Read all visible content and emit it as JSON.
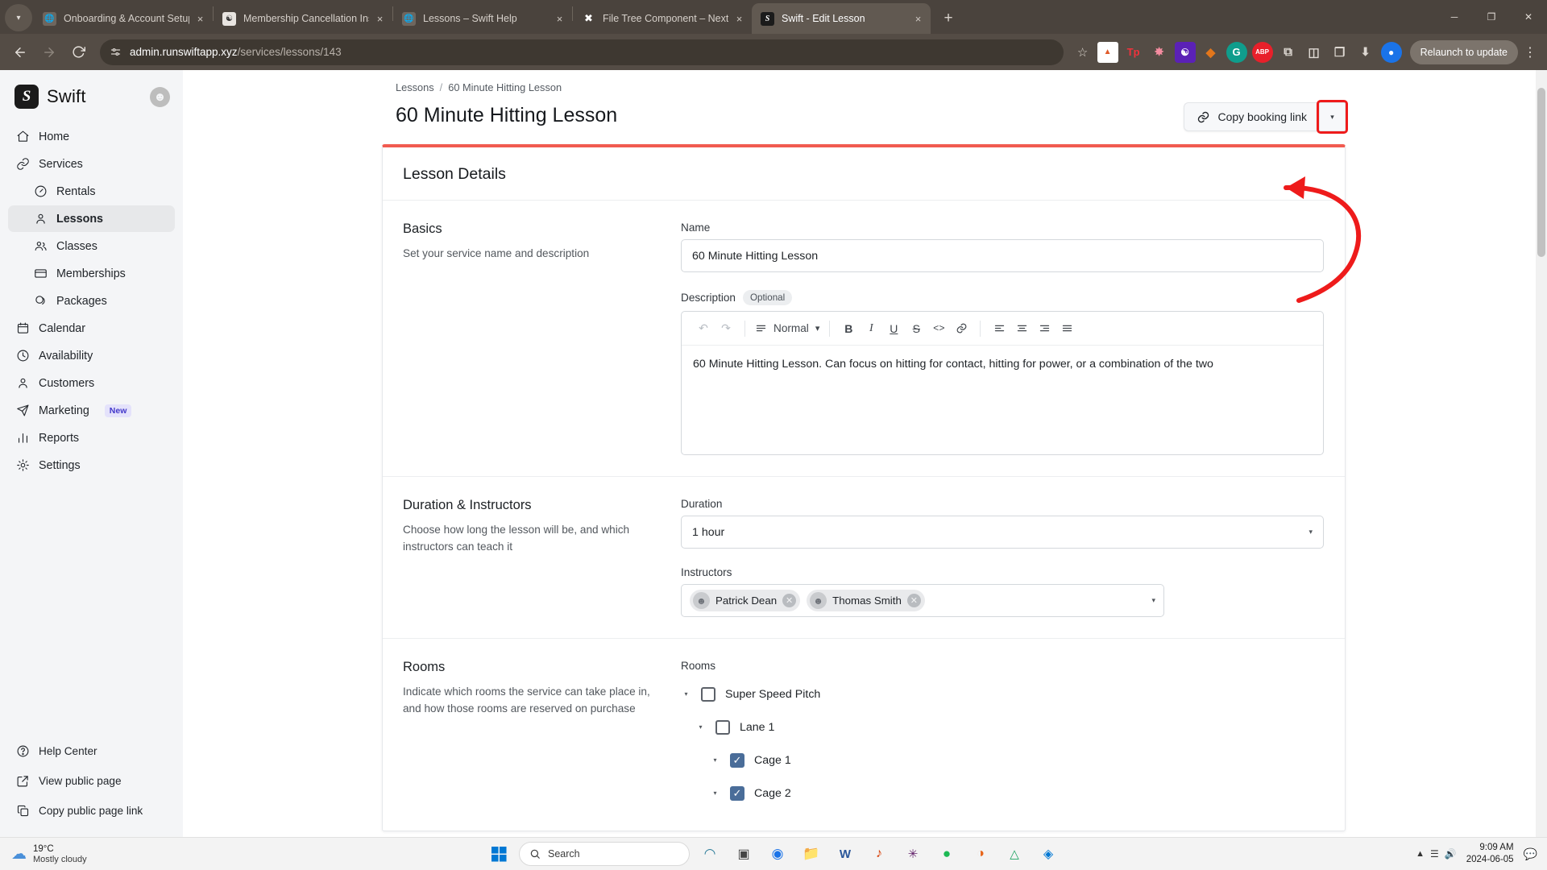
{
  "browser": {
    "tabs": [
      {
        "title": "Onboarding & Account Setup -",
        "favicon": "globe-icon",
        "active": false
      },
      {
        "title": "Membership Cancellation Instr",
        "favicon": "spiral-icon",
        "active": false
      },
      {
        "title": "Lessons – Swift Help",
        "favicon": "globe-icon",
        "active": false
      },
      {
        "title": "File Tree Component – Nextra",
        "favicon": "nextra-icon",
        "active": false
      },
      {
        "title": "Swift - Edit Lesson",
        "favicon": "swift-icon",
        "active": true
      }
    ],
    "close_label": "×",
    "newtab_label": "+",
    "nav": {
      "back": "←",
      "forward": "→",
      "reload": "↻"
    },
    "url": {
      "host": "admin.runswiftapp.xyz",
      "path": "/services/lessons/143"
    },
    "site_info_icon": "page-info-icon",
    "star_icon": "☆",
    "extensions": [
      {
        "name": "unpkg-extension",
        "glyph": "■",
        "bg": "#ffffff",
        "fg": "#e05b2a"
      },
      {
        "name": "testing-platform-extension",
        "glyph": "Tp",
        "bg": "#4a433d",
        "fg": "#f0323c"
      },
      {
        "name": "butterfly-extension",
        "glyph": "❈",
        "bg": "#4a433d",
        "fg": "#f58ca0"
      },
      {
        "name": "wallet-extension",
        "glyph": "⬟",
        "bg": "#5b21b6",
        "fg": "#ffffff"
      },
      {
        "name": "metamask-extension",
        "glyph": "◆",
        "bg": "#4a433d",
        "fg": "#e2761b"
      },
      {
        "name": "google-extension",
        "glyph": "G",
        "bg": "#0f9d8c",
        "fg": "#ffffff"
      },
      {
        "name": "adblock-plus-extension",
        "glyph": "ABP",
        "bg": "#e8202a",
        "fg": "#ffffff"
      }
    ],
    "download_icon": "⬇",
    "profile_icon": "profile-avatar",
    "extensions_puzzle_icon": "⧉",
    "relaunch_label": "Relaunch to update",
    "menu_icon": "⋮",
    "window": {
      "minimize": "─",
      "maximize": "❐",
      "close": "✕"
    }
  },
  "sidebar": {
    "brand": "Swift",
    "logo_glyph": "S",
    "items": [
      {
        "label": "Home",
        "icon": "home-icon",
        "level": 0,
        "active": false
      },
      {
        "label": "Services",
        "icon": "link-icon",
        "level": 0,
        "active": false
      },
      {
        "label": "Rentals",
        "icon": "gauge-icon",
        "level": 1,
        "active": false
      },
      {
        "label": "Lessons",
        "icon": "person-icon",
        "level": 1,
        "active": true
      },
      {
        "label": "Classes",
        "icon": "people-icon",
        "level": 1,
        "active": false
      },
      {
        "label": "Memberships",
        "icon": "card-icon",
        "level": 1,
        "active": false
      },
      {
        "label": "Packages",
        "icon": "coins-icon",
        "level": 1,
        "active": false
      },
      {
        "label": "Calendar",
        "icon": "calendar-icon",
        "level": 0,
        "active": false
      },
      {
        "label": "Availability",
        "icon": "clock-icon",
        "level": 0,
        "active": false
      },
      {
        "label": "Customers",
        "icon": "person-icon",
        "level": 0,
        "active": false
      },
      {
        "label": "Marketing",
        "icon": "send-icon",
        "level": 0,
        "active": false,
        "badge": "New"
      },
      {
        "label": "Reports",
        "icon": "bars-icon",
        "level": 0,
        "active": false
      },
      {
        "label": "Settings",
        "icon": "gear-icon",
        "level": 0,
        "active": false
      }
    ],
    "footer_items": [
      {
        "label": "Help Center",
        "icon": "question-circle-icon"
      },
      {
        "label": "View public page",
        "icon": "external-link-icon"
      },
      {
        "label": "Copy public page link",
        "icon": "copy-icon"
      }
    ]
  },
  "page": {
    "breadcrumb": {
      "parent": "Lessons",
      "separator": "/",
      "current": "60 Minute Hitting Lesson"
    },
    "title": "60 Minute Hitting Lesson",
    "copy_booking_link_label": "Copy booking link",
    "copy_booking_link_icon": "link-icon",
    "copy_booking_caret": "▾",
    "accent_color": "#f15b50",
    "highlight_color": "#ee1b1b"
  },
  "card": {
    "title": "Lesson Details",
    "sections": [
      {
        "heading": "Basics",
        "description": "Set your service name and description",
        "fields": {
          "name_label": "Name",
          "name_value": "60 Minute Hitting Lesson",
          "description_label": "Description",
          "description_optional_badge": "Optional",
          "description_value": "60 Minute Hitting Lesson. Can focus on hitting for contact, hitting for power, or a combination of the two"
        },
        "editor_toolbar": {
          "undo": "undo-icon",
          "redo": "redo-icon",
          "style_icon": "paragraph-icon",
          "style_label": "Normal",
          "style_caret": "⌄",
          "bold": "B",
          "italic": "I",
          "underline": "U",
          "strikethrough": "S",
          "code": "<>",
          "link": "link-icon",
          "align_left": "align-left-icon",
          "align_center": "align-center-icon",
          "align_right": "align-right-icon",
          "align_justify": "align-justify-icon"
        }
      },
      {
        "heading": "Duration & Instructors",
        "description": "Choose how long the lesson will be, and which instructors can teach it",
        "fields": {
          "duration_label": "Duration",
          "duration_value": "1 hour",
          "instructors_label": "Instructors",
          "instructors": [
            {
              "name": "Patrick Dean",
              "remove_label": "✕"
            },
            {
              "name": "Thomas Smith",
              "remove_label": "✕"
            }
          ]
        }
      },
      {
        "heading": "Rooms",
        "description": "Indicate which rooms the service can take place in, and how those rooms are reserved on purchase",
        "fields": {
          "rooms_label": "Rooms",
          "tree": [
            {
              "label": "Super Speed Pitch",
              "depth": 0,
              "checked": false
            },
            {
              "label": "Lane 1",
              "depth": 1,
              "checked": false
            },
            {
              "label": "Cage 1",
              "depth": 2,
              "checked": true
            },
            {
              "label": "Cage 2",
              "depth": 2,
              "checked": true
            }
          ]
        }
      }
    ]
  },
  "taskbar": {
    "weather": {
      "temp": "19°C",
      "desc": "Mostly cloudy",
      "icon": "cloud-icon"
    },
    "start_icon": "windows-icon",
    "search_placeholder": "Search",
    "search_icon": "search-icon",
    "apps": [
      {
        "name": "copilot-taskbar-icon",
        "glyph": "◩",
        "fg": "#2d7d9a"
      },
      {
        "name": "task-view-taskbar-icon",
        "glyph": "▣",
        "fg": "#444"
      },
      {
        "name": "chrome-taskbar-icon",
        "glyph": "◉",
        "fg": "#1a73e8"
      },
      {
        "name": "file-explorer-taskbar-icon",
        "glyph": "▬",
        "fg": "#f2b01e"
      },
      {
        "name": "word-taskbar-icon",
        "glyph": "W",
        "fg": "#2b579a"
      },
      {
        "name": "music-taskbar-icon",
        "glyph": "♪",
        "fg": "#d83b01"
      },
      {
        "name": "slack-taskbar-icon",
        "glyph": "✳",
        "fg": "#611f69"
      },
      {
        "name": "spotify-taskbar-icon",
        "glyph": "●",
        "fg": "#1db954"
      },
      {
        "name": "audacity-taskbar-icon",
        "glyph": "◑",
        "fg": "#e8651a"
      },
      {
        "name": "drive-taskbar-icon",
        "glyph": "△",
        "fg": "#1aa260"
      },
      {
        "name": "vscode-taskbar-icon",
        "glyph": "◈",
        "fg": "#0078d4"
      }
    ],
    "clock": {
      "time": "9:09 AM",
      "date": "2024-06-05"
    },
    "tray": [
      {
        "name": "chevron-up-tray-icon",
        "glyph": "⌃"
      },
      {
        "name": "network-tray-icon",
        "glyph": "▰"
      },
      {
        "name": "volume-tray-icon",
        "glyph": "◀"
      }
    ]
  }
}
